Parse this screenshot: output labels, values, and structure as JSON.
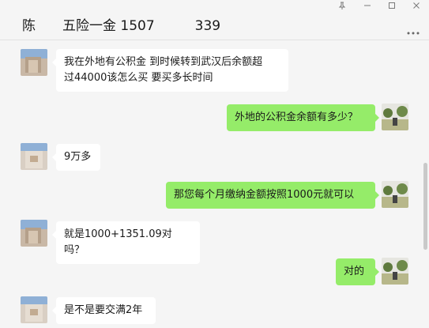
{
  "window": {
    "title": "陈  五险一金 1507   339",
    "controls": {
      "pin_icon": "pin-icon",
      "minimize_icon": "minimize-icon",
      "maximize_icon": "maximize-icon",
      "close_icon": "close-icon"
    },
    "more_icon": "more-dots-icon"
  },
  "colors": {
    "background": "#f5f5f5",
    "self_bubble": "#95ec69",
    "other_bubble": "#ffffff"
  },
  "messages": [
    {
      "from": "other",
      "text_lines": [
        "我在外地有公积金  到时候转到武汉后余额超",
        "过44000该怎么买  要买多长时间"
      ]
    },
    {
      "from": "self",
      "text": "外地的公积金余额有多少？"
    },
    {
      "from": "other",
      "text": "9万多"
    },
    {
      "from": "self",
      "text": "那您每个月缴纳金额按照1000元就可以"
    },
    {
      "from": "other",
      "text": "就是1000+1351.09对吗？"
    },
    {
      "from": "self",
      "text": "对的"
    },
    {
      "from": "other",
      "text": "是不是要交满2年"
    }
  ]
}
